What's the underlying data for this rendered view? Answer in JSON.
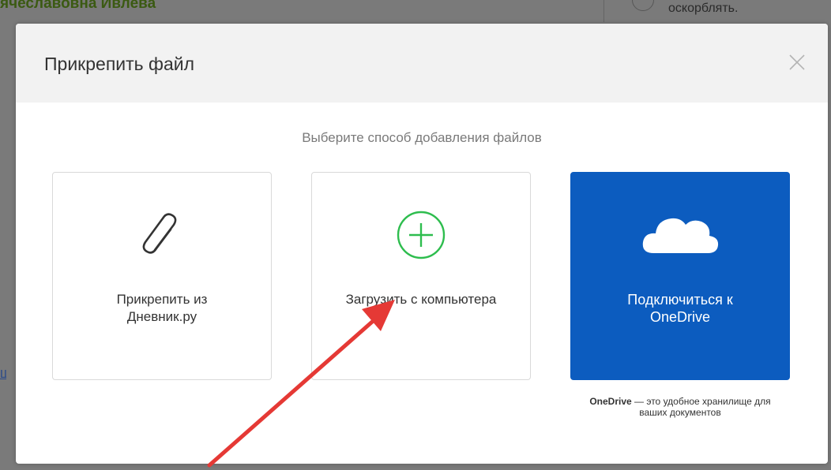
{
  "background": {
    "user_name": "ячеславовна Ивлева",
    "right_text": "оскорблять."
  },
  "modal": {
    "title": "Прикрепить файл",
    "close_icon": "close-icon",
    "subtitle": "Выберите способ добавления файлов",
    "options": [
      {
        "label_line1": "Прикрепить из",
        "label_line2": "Дневник.ру",
        "icon": "paperclip-icon"
      },
      {
        "label_line1": "Загрузить с компьютера",
        "icon": "plus-circle-icon"
      },
      {
        "label_line1": "Подключиться к",
        "label_line2": "OneDrive",
        "icon": "cloud-icon",
        "bg_color": "#0c5cbf"
      }
    ],
    "onedrive_note": {
      "brand": "OneDrive",
      "text": " — это удобное хранилище для ваших документов"
    }
  },
  "colors": {
    "accent_green": "#2ebd4e",
    "onedrive_blue": "#0c5cbf",
    "arrow_red": "#e53935"
  }
}
